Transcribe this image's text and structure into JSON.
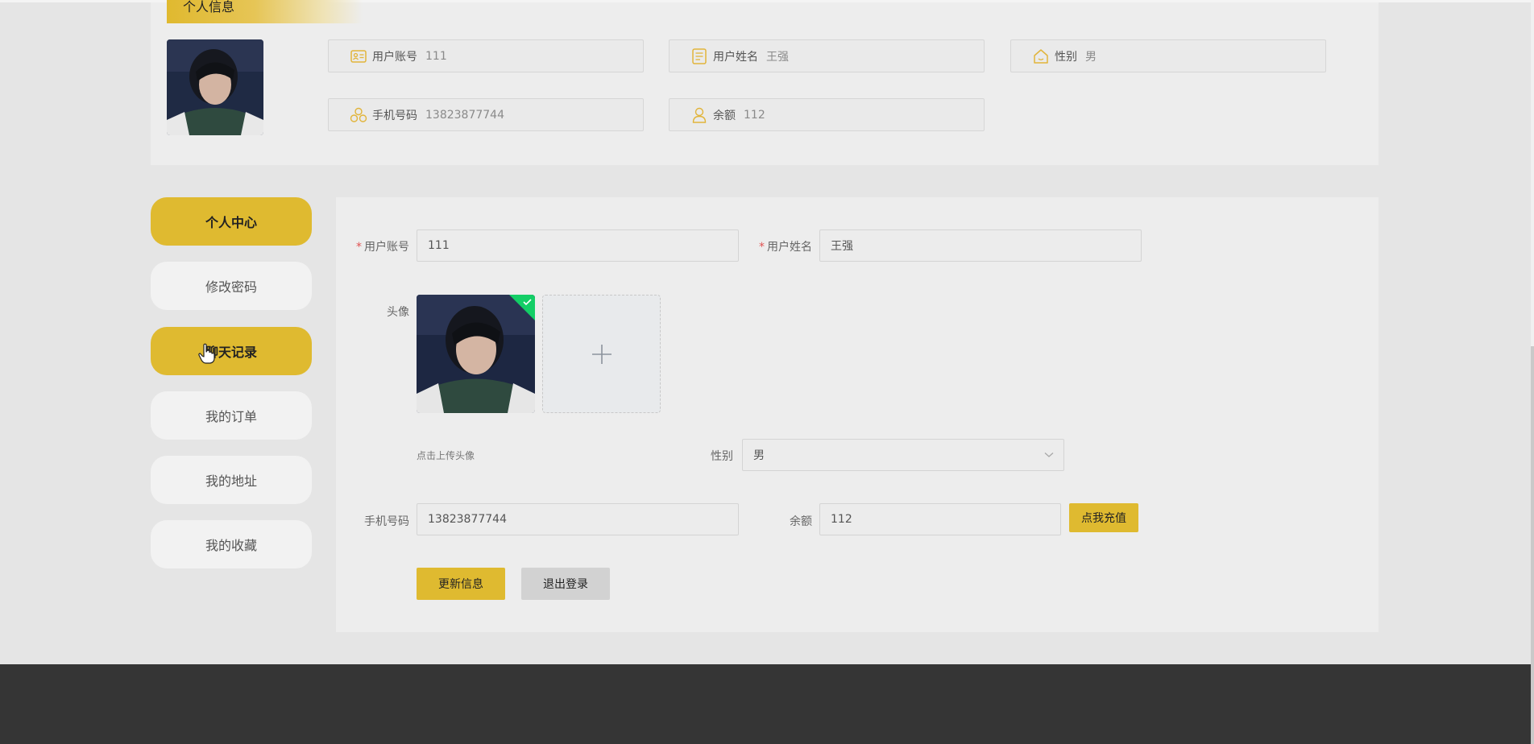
{
  "profile": {
    "section_title": "个人信息",
    "fields": [
      {
        "icon": "id-card-icon",
        "label": "用户账号",
        "value": "111"
      },
      {
        "icon": "document-icon",
        "label": "用户姓名",
        "value": "王强"
      },
      {
        "icon": "home-icon",
        "label": "性别",
        "value": "男"
      },
      {
        "icon": "cubes-icon",
        "label": "手机号码",
        "value": "13823877744"
      },
      {
        "icon": "user-icon",
        "label": "余额",
        "value": "112"
      }
    ]
  },
  "menu": {
    "items": [
      {
        "label": "个人中心",
        "active": true
      },
      {
        "label": "修改密码",
        "active": false
      },
      {
        "label": "聊天记录",
        "active": true
      },
      {
        "label": "我的订单",
        "active": false
      },
      {
        "label": "我的地址",
        "active": false
      },
      {
        "label": "我的收藏",
        "active": false
      }
    ]
  },
  "form": {
    "account_label": "用户账号",
    "account_value": "111",
    "name_label": "用户姓名",
    "name_value": "王强",
    "avatar_label": "头像",
    "upload_hint": "点击上传头像",
    "gender_label": "性别",
    "gender_value": "男",
    "phone_label": "手机号码",
    "phone_value": "13823877744",
    "balance_label": "余额",
    "balance_value": "112",
    "recharge_button": "点我充值",
    "update_button": "更新信息",
    "logout_button": "退出登录"
  },
  "colors": {
    "accent": "#dfba30",
    "icon_accent": "#e1b43a",
    "required": "#e05252",
    "upload_success": "#13ce66",
    "footer": "#353535"
  }
}
